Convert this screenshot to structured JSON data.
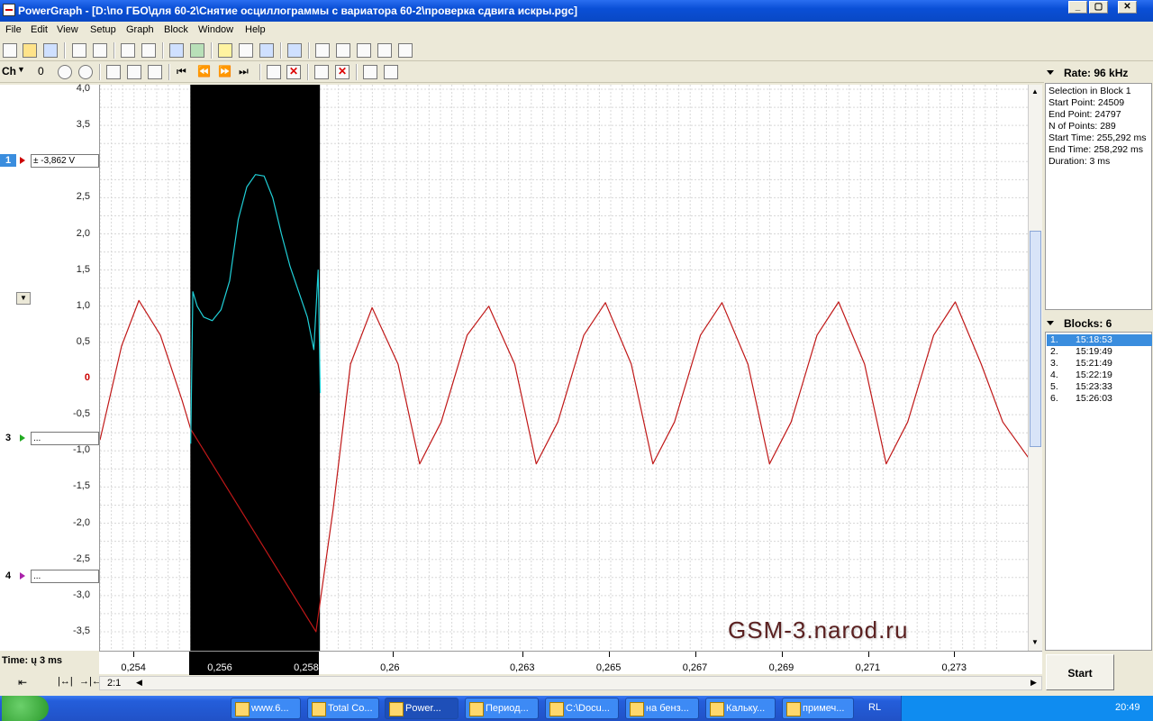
{
  "window": {
    "title": "PowerGraph - [D:\\по ГБО\\для 60-2\\Снятие осциллограммы с вариатора 60-2\\проверка сдвига искры.pgc]"
  },
  "menu": [
    "File",
    "Edit",
    "View",
    "Setup",
    "Graph",
    "Block",
    "Window",
    "Help"
  ],
  "toolbar2": {
    "ch_label": "Ch",
    "zero_label": "0"
  },
  "channels": [
    {
      "num": "1",
      "value": "± -3,862 V",
      "color": "#d42020"
    },
    {
      "num": "3",
      "value": "...",
      "color": "#22aa22"
    },
    {
      "num": "4",
      "value": "...",
      "color": "#aa22aa"
    }
  ],
  "rate": {
    "label": "Rate: 96 kHz"
  },
  "selection": {
    "lines": [
      "Selection in Block 1",
      "Start Point: 24509",
      "End Point: 24797",
      "N of Points: 289",
      "Start Time: 255,292 ms",
      "End Time: 258,292 ms",
      "Duration: 3 ms"
    ]
  },
  "blocks": {
    "label": "Blocks: 6",
    "items": [
      {
        "n": "1.",
        "time": "15:18:53"
      },
      {
        "n": "2.",
        "time": "15:19:49"
      },
      {
        "n": "3.",
        "time": "15:21:49"
      },
      {
        "n": "4.",
        "time": "15:22:19"
      },
      {
        "n": "5.",
        "time": "15:23:33"
      },
      {
        "n": "6.",
        "time": "15:26:03"
      }
    ]
  },
  "bottom": {
    "time_label": "Time: ų 3 ms",
    "scale_label": "2:1",
    "start_button": "Start"
  },
  "watermark": "GSM-3.narod.ru",
  "chart_data": {
    "type": "line",
    "ylim": [
      -3.5,
      4.0
    ],
    "yticks": [
      "4,0",
      "3,5",
      "3,0",
      "2,5",
      "2,0",
      "1,5",
      "1,0",
      "0,5",
      "0",
      "-0,5",
      "-1,0",
      "-1,5",
      "-2,0",
      "-2,5",
      "-3,0",
      "-3,5"
    ],
    "xlim": [
      0.2532,
      0.2747
    ],
    "xticks": [
      "0,254",
      "0,256",
      "0,258",
      "0,26",
      "0,263",
      "0,265",
      "0,267",
      "0,269",
      "0,271",
      "0,273"
    ],
    "xtick_values": [
      0.254,
      0.256,
      0.258,
      0.26,
      0.263,
      0.265,
      0.267,
      0.269,
      0.271,
      0.273
    ],
    "selection": [
      0.255292,
      0.258292
    ],
    "series": [
      {
        "color": "#c01818",
        "x": [
          0.2532,
          0.2537,
          0.2541,
          0.2546,
          0.2551,
          0.2553,
          0.2582,
          0.2586,
          0.259,
          0.2595,
          0.2601,
          0.2606,
          0.2611,
          0.2617,
          0.2622,
          0.2628,
          0.2633,
          0.2638,
          0.2644,
          0.2649,
          0.2655,
          0.266,
          0.2665,
          0.2671,
          0.2676,
          0.2682,
          0.2687,
          0.2692,
          0.2698,
          0.2703,
          0.2709,
          0.2714,
          0.2719,
          0.2725,
          0.273,
          0.2736,
          0.2741,
          0.2747
        ],
        "y": [
          -0.85,
          0.45,
          1.08,
          0.6,
          -0.3,
          -0.7,
          -3.5,
          -1.8,
          0.2,
          0.98,
          0.2,
          -1.18,
          -0.6,
          0.6,
          1.0,
          0.2,
          -1.18,
          -0.6,
          0.6,
          1.05,
          0.2,
          -1.18,
          -0.6,
          0.6,
          1.05,
          0.2,
          -1.18,
          -0.6,
          0.6,
          1.06,
          0.2,
          -1.18,
          -0.6,
          0.6,
          1.06,
          0.2,
          -0.6,
          -1.1
        ]
      },
      {
        "color": "#20d0d8",
        "x": [
          0.2553,
          0.25535,
          0.25545,
          0.2556,
          0.2558,
          0.256,
          0.2562,
          0.2564,
          0.2566,
          0.2568,
          0.257,
          0.2572,
          0.2574,
          0.2576,
          0.2578,
          0.258,
          0.25815,
          0.25825,
          0.2583
        ],
        "y": [
          -0.9,
          1.2,
          1.0,
          0.85,
          0.8,
          0.95,
          1.35,
          2.2,
          2.65,
          2.82,
          2.8,
          2.5,
          2.0,
          1.55,
          1.2,
          0.85,
          0.4,
          1.5,
          -0.2
        ]
      }
    ]
  },
  "taskbar": {
    "tasks": [
      "www.6...",
      "Total Co...",
      "Power...",
      "Период...",
      "C:\\Docu...",
      "на бенз...",
      "Кальку...",
      "примеч..."
    ],
    "lang": "RL",
    "clock": "20:49"
  }
}
